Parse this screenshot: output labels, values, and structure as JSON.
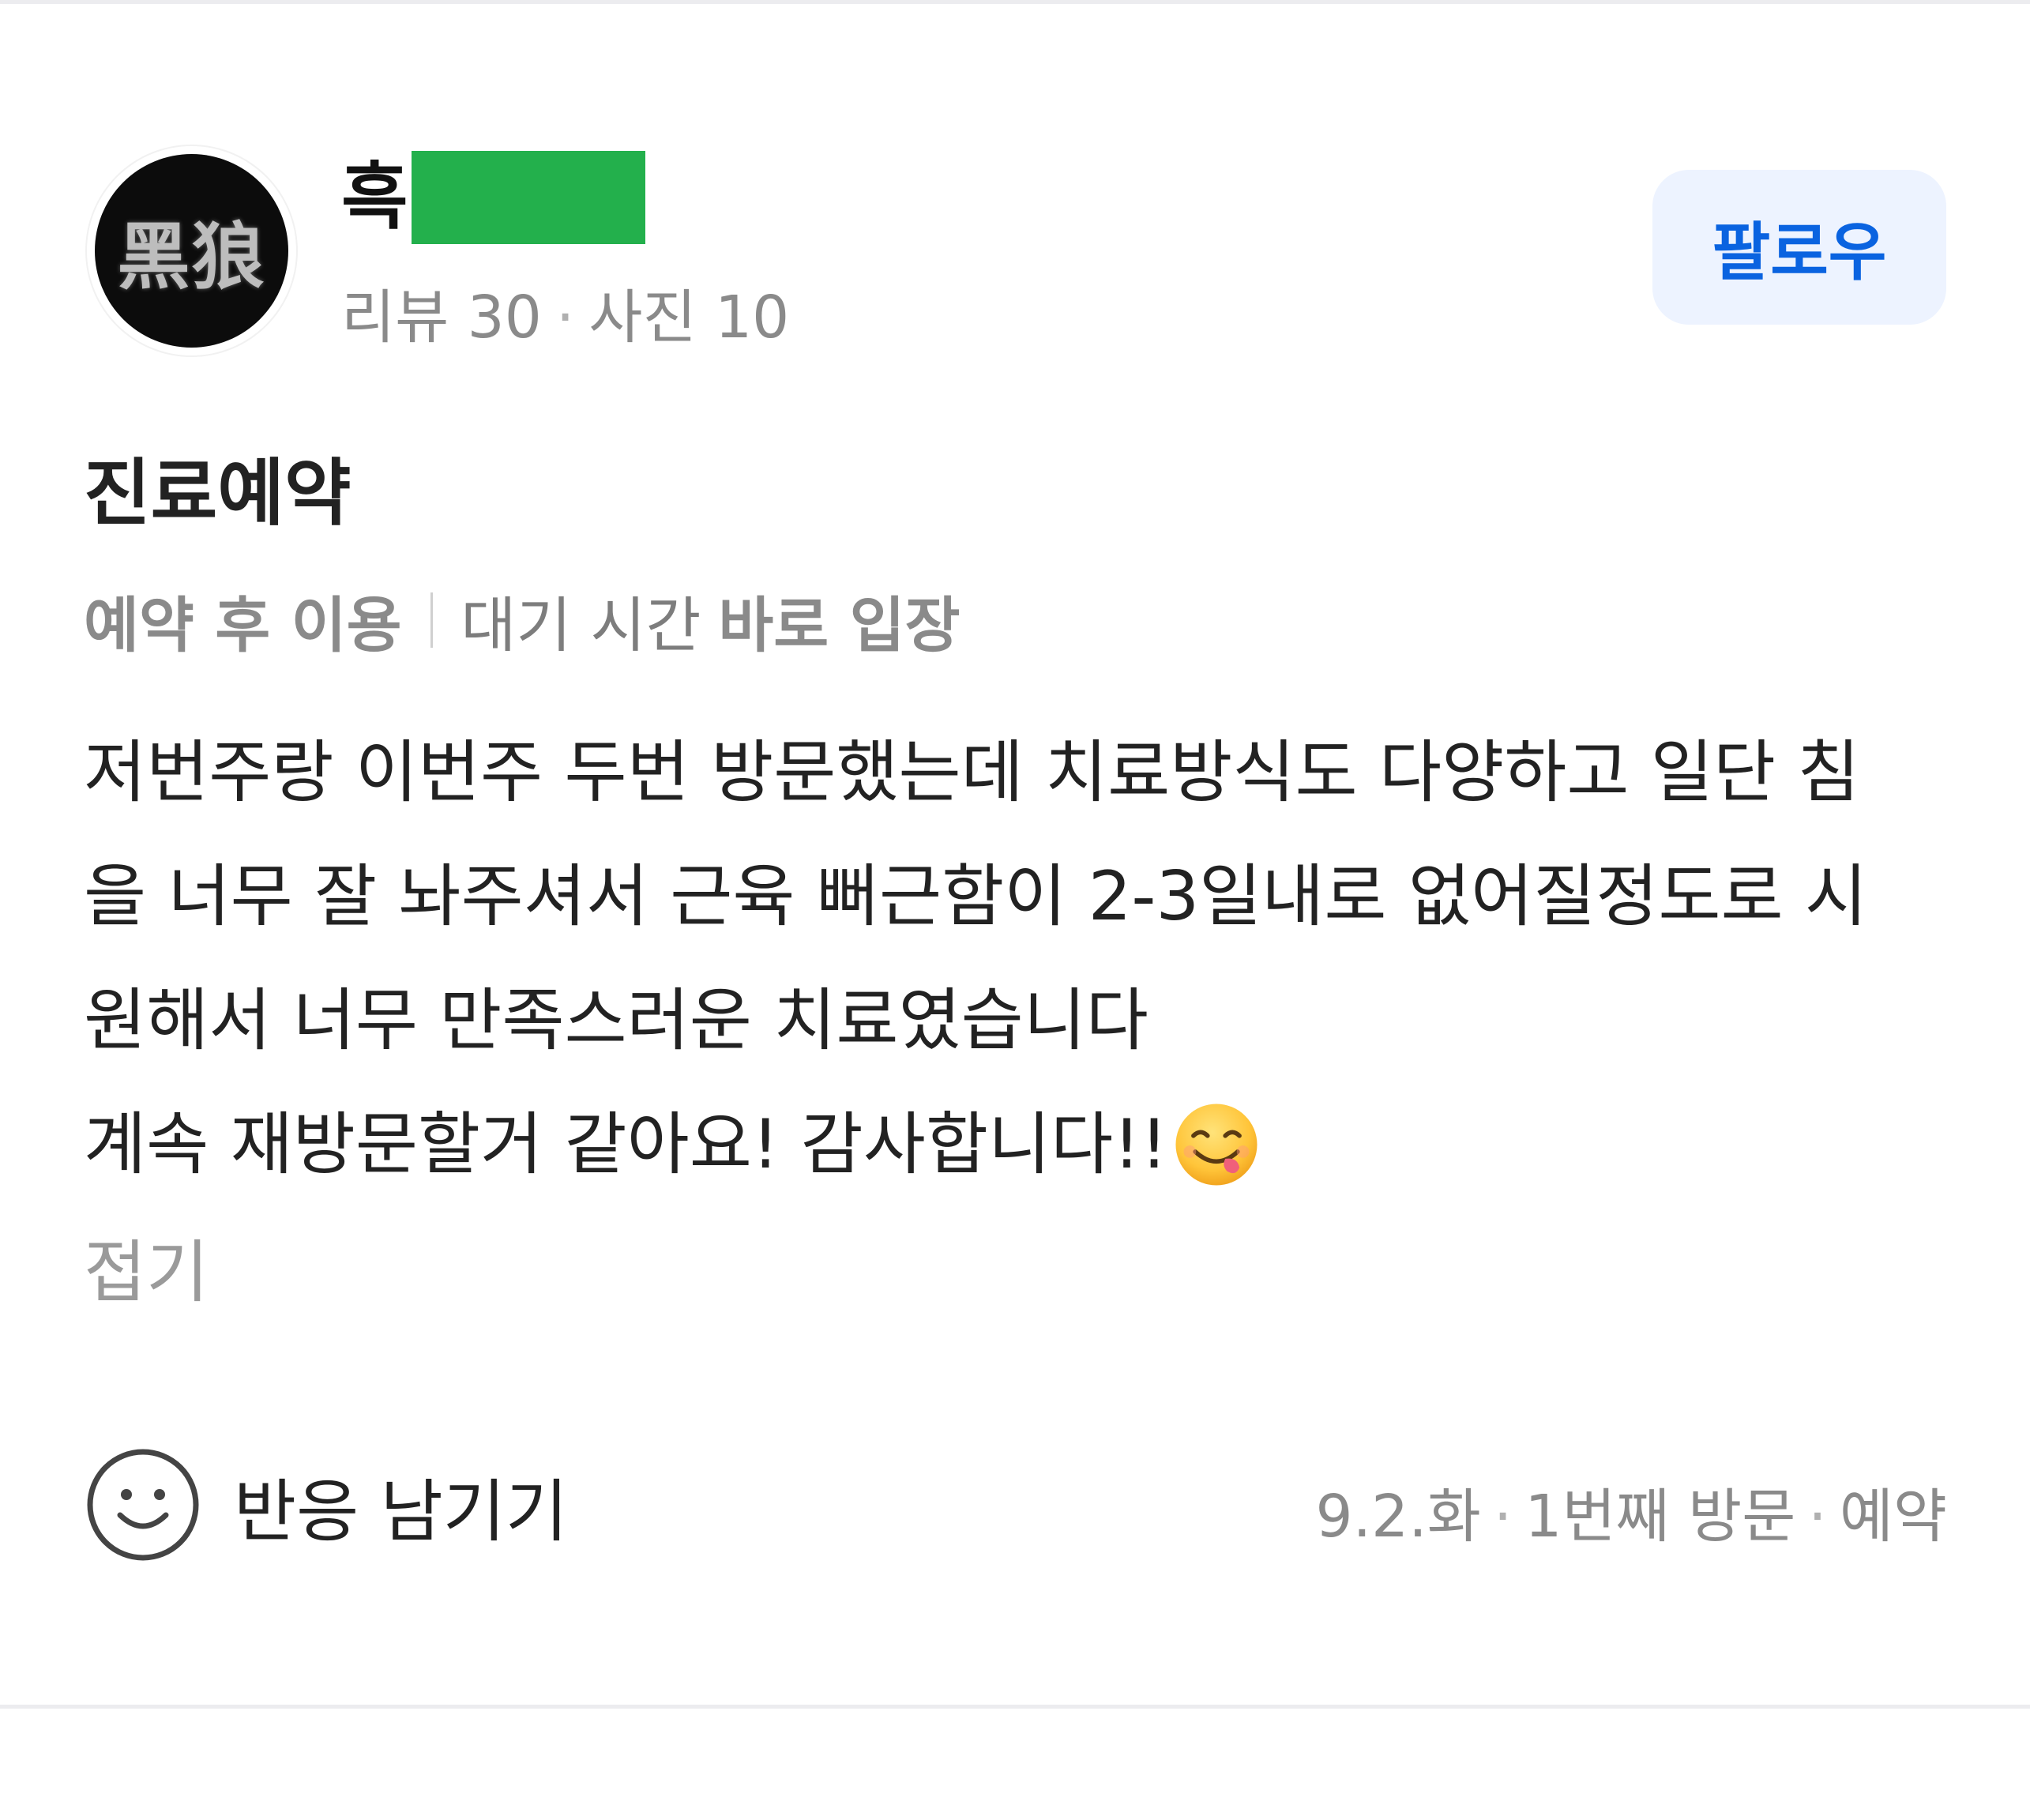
{
  "user": {
    "avatar_text": "黑狼",
    "name_visible": "흑",
    "stats": {
      "reviews": "리뷰 30",
      "photos": "사진 10",
      "separator": "·"
    },
    "follow_label": "팔로우"
  },
  "review": {
    "category": "진료예약",
    "meta": {
      "usage": "예약 후 이용",
      "wait_label": "대기 시간",
      "wait_value": "바로 입장"
    },
    "lines": [
      "저번주랑 이번주 두번 방문했는데 치료방식도 다양하고 일단 침",
      "을 너무 잘 놔주셔서 근육 뻐근함이 2-3일내로 없어질정도로 시",
      "원해서 너무 만족스러운 치료였습니다",
      "계속 재방문할거 같아요! 감사합니다!!"
    ],
    "emoji": "yum-face-emoji",
    "collapse_label": "접기"
  },
  "footer": {
    "reaction_label": "반응 남기기",
    "reaction_icon": "smile-icon",
    "date": "9.2.화",
    "visit_count": "1번째 방문",
    "visit_type": "예약",
    "separator": "·"
  },
  "colors": {
    "accent": "#0a63e0",
    "follow_bg": "#edf3ff",
    "redaction": "#23b04c",
    "muted_text": "#8a8a8a",
    "body_text": "#222222"
  }
}
